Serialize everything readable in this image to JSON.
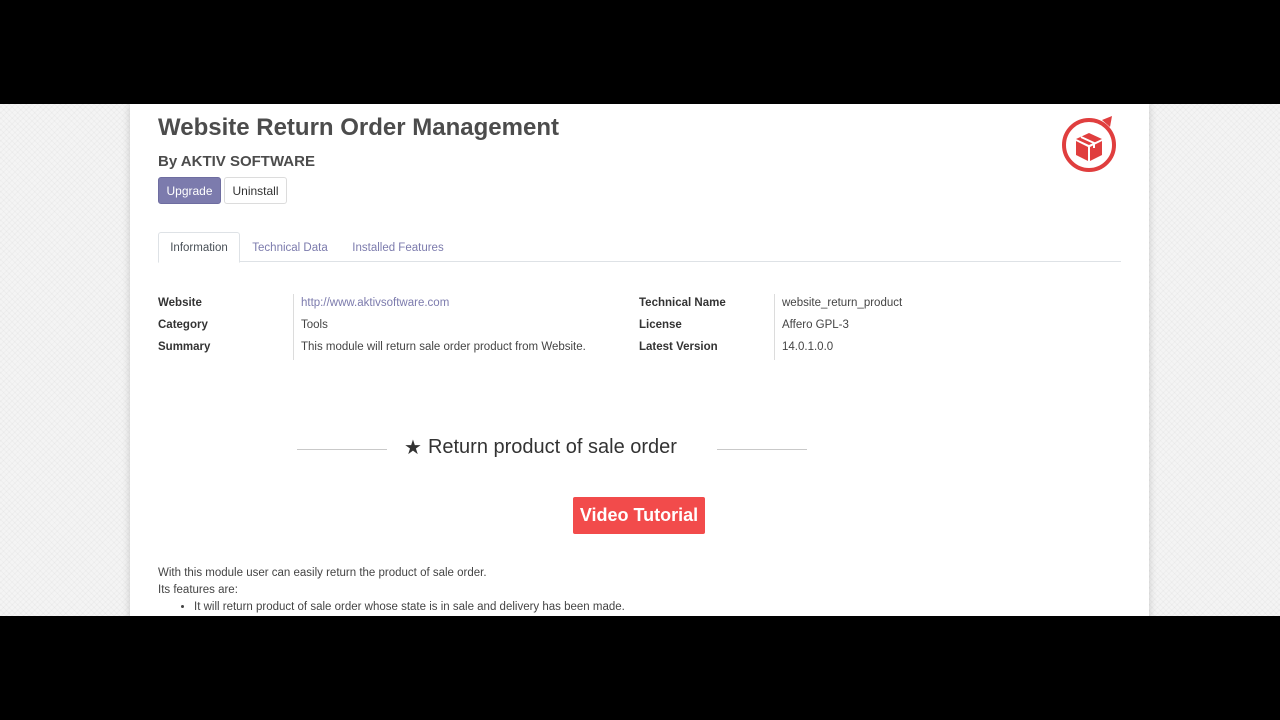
{
  "module": {
    "title": "Website Return Order Management",
    "author": "By AKTIV SOFTWARE",
    "upgrade_label": "Upgrade",
    "uninstall_label": "Uninstall",
    "icon": "return-box-icon"
  },
  "tabs": [
    "Information",
    "Technical Data",
    "Installed Features"
  ],
  "info_left": [
    {
      "label": "Website",
      "value": "http://www.aktivsoftware.com"
    },
    {
      "label": "Category",
      "value": "Tools"
    },
    {
      "label": "Summary",
      "value": "This module will return sale order product from Website."
    }
  ],
  "info_right": [
    {
      "label": "Technical Name",
      "value": "website_return_product"
    },
    {
      "label": "License",
      "value": "Affero GPL-3"
    },
    {
      "label": "Latest Version",
      "value": "14.0.1.0.0"
    }
  ],
  "section": {
    "title": "Return product of sale order",
    "icon": "star-icon",
    "video_button": "Video Tutorial"
  },
  "description": {
    "line1": "With this module user can easily return the product of sale order.",
    "line2": "Its features are:",
    "features": [
      "It will return product of sale order whose state is in sale and delivery has been made."
    ]
  },
  "colors": {
    "primary": "#7c7bad",
    "video_button": "#f24b4b",
    "icon_red": "#e03e3e"
  }
}
